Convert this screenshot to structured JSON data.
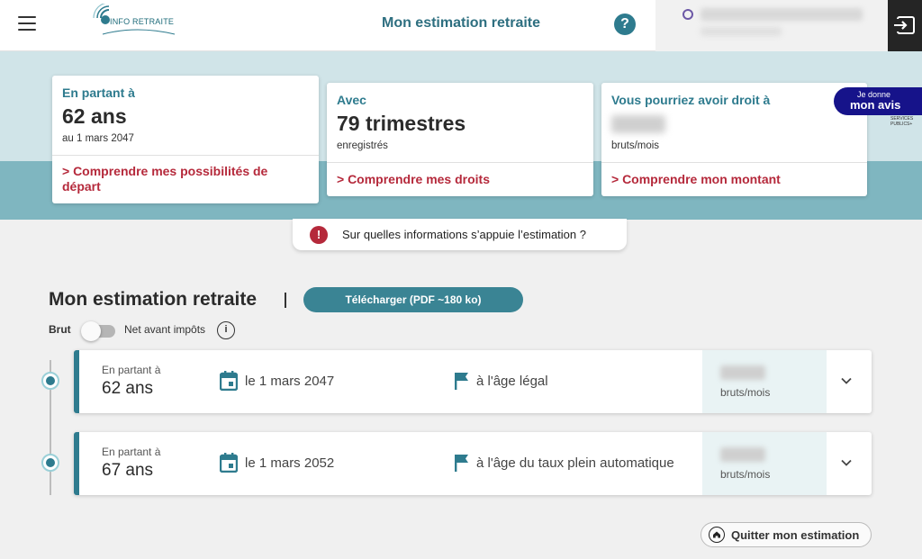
{
  "header": {
    "logo_text": "INFO RETRAITE",
    "title": "Mon estimation retraite",
    "help_label": "?"
  },
  "summary_cards": [
    {
      "label": "En partant à",
      "value": "62 ans",
      "sub": "au 1 mars 2047",
      "link": "> Comprendre mes possibilités de départ"
    },
    {
      "label": "Avec",
      "value": "79 trimestres",
      "sub": "enregistrés",
      "link": "> Comprendre mes droits"
    },
    {
      "label": "Vous pourriez avoir droit à",
      "sub": "bruts/mois",
      "link": "> Comprendre mon montant"
    }
  ],
  "feedback": {
    "small": "Je donne",
    "big": "mon avis",
    "services": "SERVICES PUBLICS+"
  },
  "info_banner": {
    "text": "Sur quelles informations s’appuie l’estimation ?",
    "icon": "!"
  },
  "section": {
    "title": "Mon estimation retraite",
    "download_label": "Télécharger (PDF ~180 ko)",
    "toggle_left": "Brut",
    "toggle_right": "Net avant impôts",
    "toggle_on": false,
    "info_icon": "i"
  },
  "estimations": [
    {
      "label": "En partant à",
      "age": "62 ans",
      "date": "le 1 mars 2047",
      "condition": "à l'âge légal",
      "unit": "bruts/mois"
    },
    {
      "label": "En partant à",
      "age": "67 ans",
      "date": "le 1 mars 2052",
      "condition": "à l'âge du taux plein automatique",
      "unit": "bruts/mois"
    }
  ],
  "quit_label": "Quitter mon estimation",
  "colors": {
    "teal": "#2e7b8e",
    "accent_red": "#b5293b",
    "band_light": "#d0e4e8",
    "band_dark": "#7fb6c0",
    "feedback_blue": "#16138a"
  }
}
